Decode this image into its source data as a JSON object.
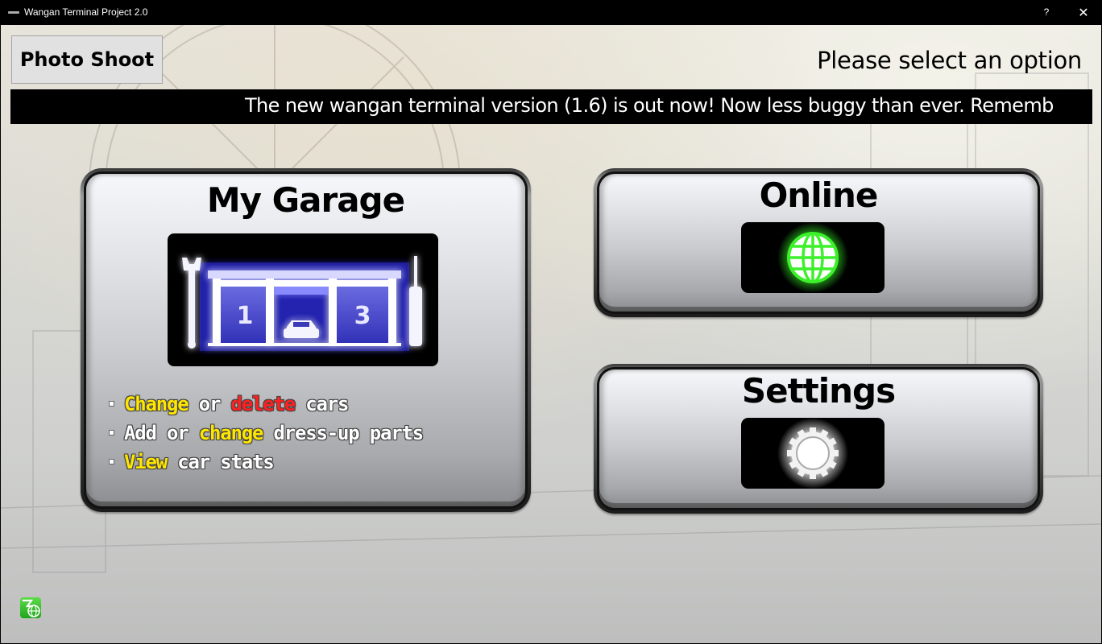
{
  "titlebar": {
    "title": "Wangan Terminal Project 2.0",
    "help_label": "?",
    "close_label": "✕"
  },
  "header": {
    "photo_shoot_label": "Photo Shoot",
    "prompt": "Please select an option",
    "ticker": "The new wangan terminal version (1.6) is out now! Now less buggy than ever. Rememb"
  },
  "cards": {
    "garage": {
      "title": "My Garage",
      "image_icon": "garage-icon",
      "garage_bay_labels": [
        "1",
        "3"
      ],
      "features": [
        {
          "parts": [
            {
              "text": "Change",
              "style": "yellow"
            },
            {
              "text": " or ",
              "style": "white"
            },
            {
              "text": "delete",
              "style": "red"
            },
            {
              "text": " cars",
              "style": "white"
            }
          ]
        },
        {
          "parts": [
            {
              "text": "Add or ",
              "style": "white"
            },
            {
              "text": "change",
              "style": "yellow"
            },
            {
              "text": " dress-up parts",
              "style": "white"
            }
          ]
        },
        {
          "parts": [
            {
              "text": "View",
              "style": "yellow"
            },
            {
              "text": " car stats",
              "style": "white"
            }
          ]
        }
      ]
    },
    "online": {
      "title": "Online",
      "icon": "globe-icon",
      "glow_color": "#39ff2a"
    },
    "settings": {
      "title": "Settings",
      "icon": "gear-icon",
      "glow_color": "#ffffff"
    }
  },
  "footer": {
    "logo_icon": "network-logo-icon"
  },
  "colors": {
    "highlight_yellow": "#ffe600",
    "highlight_red": "#ff2020",
    "ticker_bg": "#000000",
    "garage_glow": "#3b3bff"
  }
}
